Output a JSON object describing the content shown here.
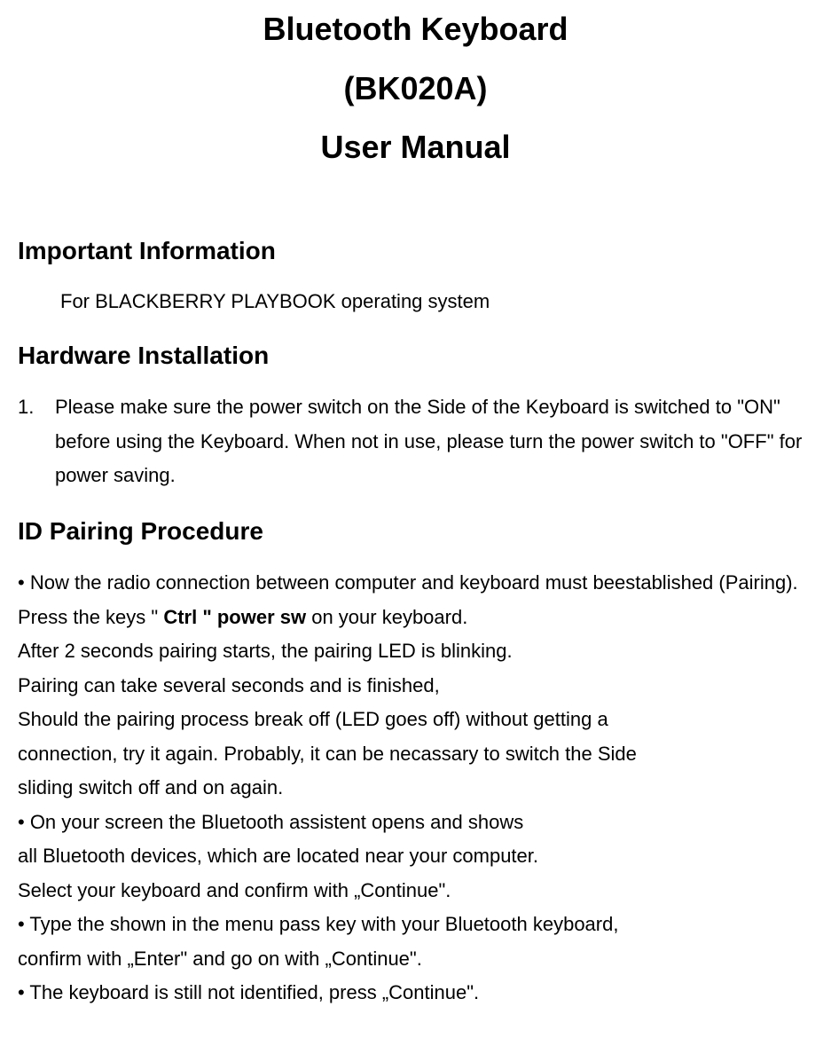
{
  "title": {
    "line1": "Bluetooth Keyboard",
    "line2": "(BK020A)",
    "line3": "User Manual"
  },
  "sections": {
    "important": {
      "heading": "Important Information",
      "body": "For BLACKBERRY PLAYBOOK operating system"
    },
    "hardware": {
      "heading": "Hardware Installation",
      "item_num": "1.",
      "item_text": "Please make sure the power switch on the Side of the Keyboard is switched to \"ON\" before using the Keyboard. When not in use, please turn the power switch to \"OFF\" for power saving."
    },
    "pairing": {
      "heading": "ID Pairing Procedure",
      "p1_prefix": "• Now the radio connection between computer and keyboard must beestablished (Pairing). Press the keys \" ",
      "p1_bold": "Ctrl \" power sw",
      "p1_suffix": " on your keyboard.",
      "p2": "After 2 seconds pairing starts, the pairing LED is blinking.",
      "p3": "Pairing can take several seconds and is finished,",
      "p4": "Should the pairing process break off (LED goes off) without getting a",
      "p5": "connection, try it again. Probably, it can be necassary to switch the Side",
      "p6": "sliding switch off and on again.",
      "p7": "• On your screen the Bluetooth assistent opens and shows",
      "p8": "all Bluetooth devices, which are located near your computer.",
      "p9": "Select your keyboard and confirm with „Continue\".",
      "p10": "• Type the shown in the menu pass key with your Bluetooth keyboard,",
      "p11": "confirm with „Enter\" and go on with „Continue\".",
      "p12": "• The keyboard is still not identified, press „Continue\"."
    }
  }
}
